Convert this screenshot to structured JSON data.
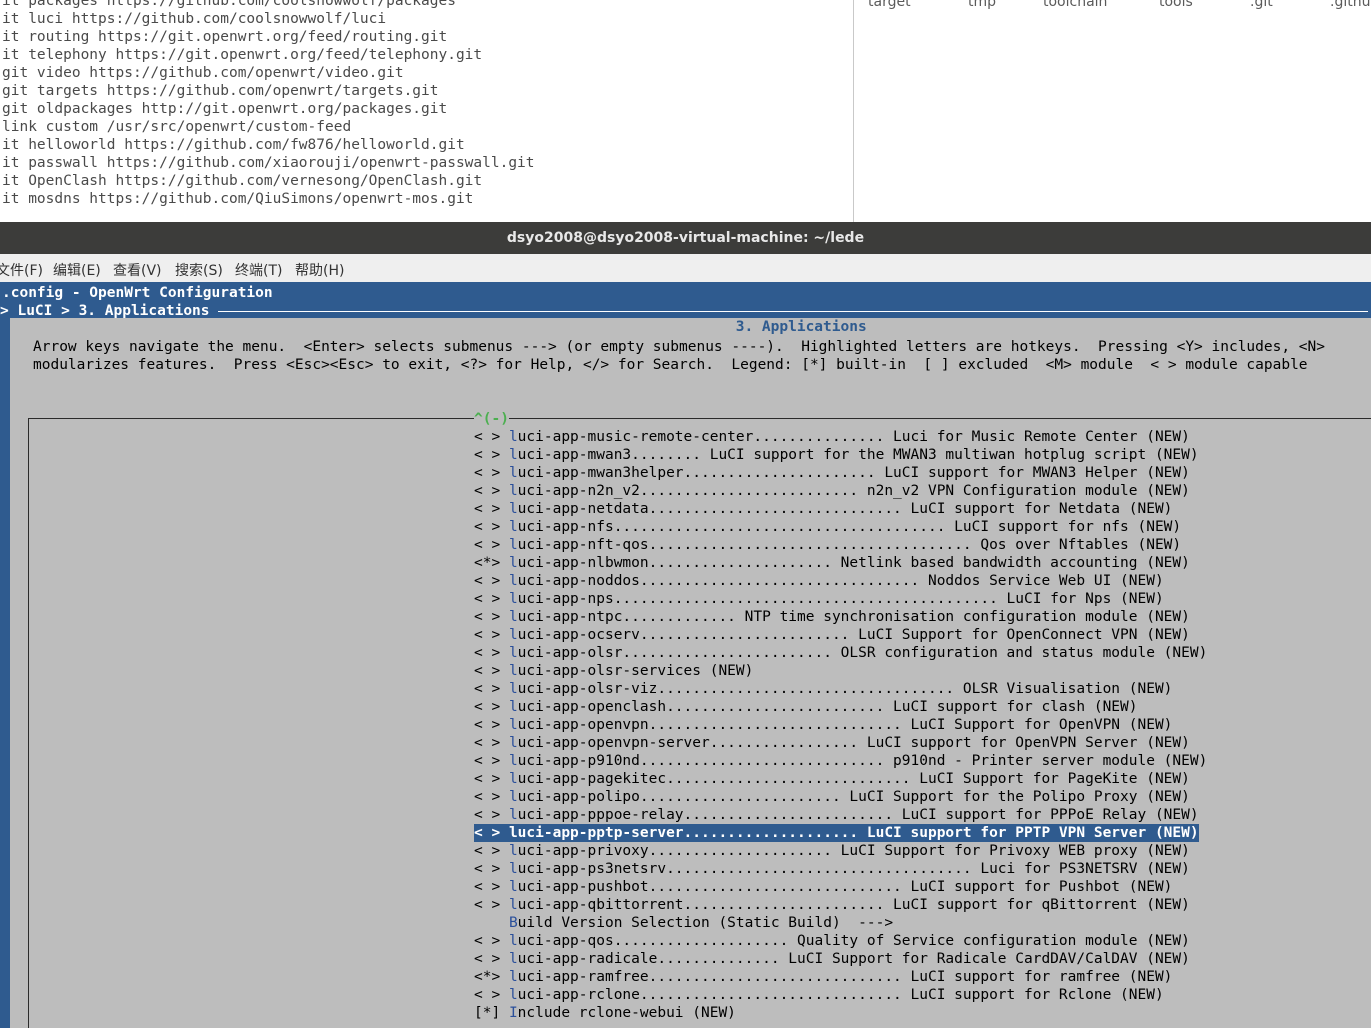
{
  "background_terminal": {
    "lines": [
      "it packages https://github.com/coolsnowwolf/packages",
      "it luci https://github.com/coolsnowwolf/luci",
      "it routing https://git.openwrt.org/feed/routing.git",
      "it telephony https://git.openwrt.org/feed/telephony.git",
      "git video https://github.com/openwrt/video.git",
      "git targets https://github.com/openwrt/targets.git",
      "git oldpackages http://git.openwrt.org/packages.git",
      "link custom /usr/src/openwrt/custom-feed",
      "it helloworld https://github.com/fw876/helloworld.git",
      "it passwall https://github.com/xiaorouji/openwrt-passwall.git",
      "it OpenClash https://github.com/vernesong/OpenClash.git",
      "it mosdns https://github.com/QiuSimons/openwrt-mos.git"
    ]
  },
  "file_manager": {
    "items": [
      "target",
      "tmp",
      "toolchain",
      "tools",
      ".git",
      ".github"
    ]
  },
  "window": {
    "title": "dsyo2008@dsyo2008-virtual-machine: ~/lede"
  },
  "menubar": {
    "items": [
      "文件(F)",
      "编辑(E)",
      "查看(V)",
      "搜索(S)",
      "终端(T)",
      "帮助(H)"
    ]
  },
  "menuconfig": {
    "header": ".config - OpenWrt Configuration",
    "breadcrumb": "> LuCI > 3. Applications ",
    "dialog_title": " 3. Applications ",
    "help_line1": "Arrow keys navigate the menu.  <Enter> selects submenus ---> (or empty submenus ----).  Highlighted letters are hotkeys.  Pressing <Y> includes, <N>",
    "help_line2": "modularizes features.  Press <Esc><Esc> to exit, <?> for Help, </> for Search.  Legend: [*] built-in  [ ] excluded  <M> module  < > module capable",
    "scroll_up": "^(-)",
    "selected_index": 22,
    "items": [
      {
        "state": "< >",
        "hot": "l",
        "text": "uci-app-music-remote-center............... Luci for Music Remote Center (NEW)"
      },
      {
        "state": "< >",
        "hot": "l",
        "text": "uci-app-mwan3........ LuCI support for the MWAN3 multiwan hotplug script (NEW)"
      },
      {
        "state": "< >",
        "hot": "l",
        "text": "uci-app-mwan3helper...................... LuCI support for MWAN3 Helper (NEW)"
      },
      {
        "state": "< >",
        "hot": "l",
        "text": "uci-app-n2n_v2......................... n2n_v2 VPN Configuration module (NEW)"
      },
      {
        "state": "< >",
        "hot": "l",
        "text": "uci-app-netdata............................. LuCI support for Netdata (NEW)"
      },
      {
        "state": "< >",
        "hot": "l",
        "text": "uci-app-nfs...................................... LuCI support for nfs (NEW)"
      },
      {
        "state": "< >",
        "hot": "l",
        "text": "uci-app-nft-qos..................................... Qos over Nftables (NEW)"
      },
      {
        "state": "<*>",
        "hot": "l",
        "text": "uci-app-nlbwmon..................... Netlink based bandwidth accounting (NEW)"
      },
      {
        "state": "< >",
        "hot": "l",
        "text": "uci-app-noddos................................ Noddos Service Web UI (NEW)"
      },
      {
        "state": "< >",
        "hot": "l",
        "text": "uci-app-nps............................................ LuCI for Nps (NEW)"
      },
      {
        "state": "< >",
        "hot": "l",
        "text": "uci-app-ntpc............. NTP time synchronisation configuration module (NEW)"
      },
      {
        "state": "< >",
        "hot": "l",
        "text": "uci-app-ocserv........................ LuCI Support for OpenConnect VPN (NEW)"
      },
      {
        "state": "< >",
        "hot": "l",
        "text": "uci-app-olsr........................ OLSR configuration and status module (NEW)"
      },
      {
        "state": "< >",
        "hot": "l",
        "text": "uci-app-olsr-services (NEW)"
      },
      {
        "state": "< >",
        "hot": "l",
        "text": "uci-app-olsr-viz.................................. OLSR Visualisation (NEW)"
      },
      {
        "state": "< >",
        "hot": "l",
        "text": "uci-app-openclash......................... LuCI support for clash (NEW)"
      },
      {
        "state": "< >",
        "hot": "l",
        "text": "uci-app-openvpn............................. LuCI Support for OpenVPN (NEW)"
      },
      {
        "state": "< >",
        "hot": "l",
        "text": "uci-app-openvpn-server................. LuCI support for OpenVPN Server (NEW)"
      },
      {
        "state": "< >",
        "hot": "l",
        "text": "uci-app-p910nd............................ p910nd - Printer server module (NEW)"
      },
      {
        "state": "< >",
        "hot": "l",
        "text": "uci-app-pagekitec............................ LuCI Support for PageKite (NEW)"
      },
      {
        "state": "< >",
        "hot": "l",
        "text": "uci-app-polipo....................... LuCI Support for the Polipo Proxy (NEW)"
      },
      {
        "state": "< >",
        "hot": "l",
        "text": "uci-app-pppoe-relay........................ LuCI support for PPPoE Relay (NEW)"
      },
      {
        "state": "< >",
        "hot": "l",
        "text": "uci-app-pptp-server.................... LuCI support for PPTP VPN Server (NEW)"
      },
      {
        "state": "< >",
        "hot": "l",
        "text": "uci-app-privoxy..................... LuCI Support for Privoxy WEB proxy (NEW)"
      },
      {
        "state": "< >",
        "hot": "l",
        "text": "uci-app-ps3netsrv................................... Luci for PS3NETSRV (NEW)"
      },
      {
        "state": "< >",
        "hot": "l",
        "text": "uci-app-pushbot............................. LuCI support for Pushbot (NEW)"
      },
      {
        "state": "< >",
        "hot": "l",
        "text": "uci-app-qbittorrent....................... LuCI support for qBittorrent (NEW)"
      },
      {
        "state": "   ",
        "hot": "B",
        "text": "uild Version Selection (Static Build)  --->"
      },
      {
        "state": "< >",
        "hot": "l",
        "text": "uci-app-qos.................... Quality of Service configuration module (NEW)"
      },
      {
        "state": "< >",
        "hot": "l",
        "text": "uci-app-radicale.............. LuCI Support for Radicale CardDAV/CalDAV (NEW)"
      },
      {
        "state": "<*>",
        "hot": "l",
        "text": "uci-app-ramfree............................. LuCI support for ramfree (NEW)"
      },
      {
        "state": "< >",
        "hot": "l",
        "text": "uci-app-rclone.............................. LuCI support for Rclone (NEW)"
      },
      {
        "state": "[*]",
        "hot": "I",
        "text": "nclude rclone-webui (NEW)"
      }
    ]
  }
}
